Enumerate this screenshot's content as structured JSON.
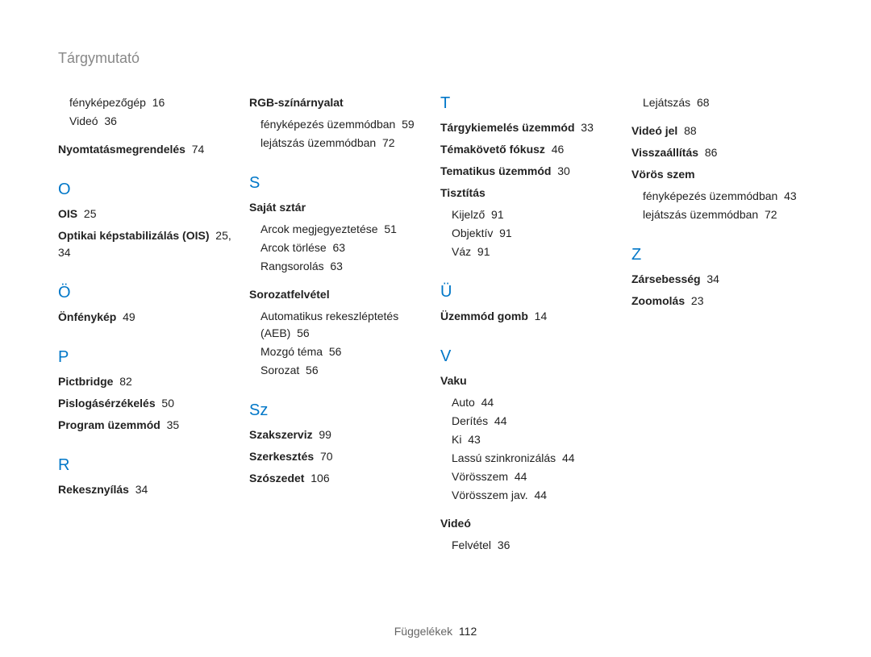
{
  "title": "Tárgymutató",
  "footer": {
    "label": "Függelékek",
    "page": "112"
  },
  "col1": {
    "cont_sub1": {
      "label": "fényképezőgép",
      "pg": "16"
    },
    "cont_sub2": {
      "label": "Videó",
      "pg": "36"
    },
    "nyomt": {
      "label": "Nyomtatásmegrendelés",
      "pg": "74"
    },
    "O": "O",
    "ois": {
      "label": "OIS",
      "pg": "25"
    },
    "optikai": {
      "label": "Optikai képstabilizálás (OIS)",
      "pg": "25, 34"
    },
    "O2": "Ö",
    "onf": {
      "label": "Önfénykép",
      "pg": "49"
    },
    "P": "P",
    "pict": {
      "label": "Pictbridge",
      "pg": "82"
    },
    "pislog": {
      "label": "Pislogásérzékelés",
      "pg": "50"
    },
    "prog": {
      "label": "Program üzemmód",
      "pg": "35"
    },
    "R": "R",
    "rekesz": {
      "label": "Rekesznyílás",
      "pg": "34"
    }
  },
  "col2": {
    "rgb": {
      "label": "RGB-színárnyalat"
    },
    "rgb_sub1": {
      "label": "fényképezés üzemmódban",
      "pg": "59"
    },
    "rgb_sub2": {
      "label": "lejátszás üzemmódban",
      "pg": "72"
    },
    "S": "S",
    "sajat": {
      "label": "Saját sztár"
    },
    "sajat_sub1": {
      "label": "Arcok megjegyeztetése",
      "pg": "51"
    },
    "sajat_sub2": {
      "label": "Arcok törlése",
      "pg": "63"
    },
    "sajat_sub3": {
      "label": "Rangsorolás",
      "pg": "63"
    },
    "sorozat": {
      "label": "Sorozatfelvétel"
    },
    "sorozat_sub1": {
      "label": "Automatikus rekeszléptetés (AEB)",
      "pg": "56"
    },
    "sorozat_sub2": {
      "label": "Mozgó téma",
      "pg": "56"
    },
    "sorozat_sub3": {
      "label": "Sorozat",
      "pg": "56"
    },
    "Sz": "Sz",
    "szak": {
      "label": "Szakszerviz",
      "pg": "99"
    },
    "szerk": {
      "label": "Szerkesztés",
      "pg": "70"
    },
    "szosz": {
      "label": "Szószedet",
      "pg": "106"
    }
  },
  "col3": {
    "T": "T",
    "targy": {
      "label": "Tárgykiemelés üzemmód",
      "pg": "33"
    },
    "temakov": {
      "label": "Témakövető fókusz",
      "pg": "46"
    },
    "tematikus": {
      "label": "Tematikus üzemmód",
      "pg": "30"
    },
    "tiszt": {
      "label": "Tisztítás"
    },
    "tiszt_sub1": {
      "label": "Kijelző",
      "pg": "91"
    },
    "tiszt_sub2": {
      "label": "Objektív",
      "pg": "91"
    },
    "tiszt_sub3": {
      "label": "Váz",
      "pg": "91"
    },
    "U": "Ü",
    "uzemmod": {
      "label": "Üzemmód gomb",
      "pg": "14"
    },
    "V": "V",
    "vaku": {
      "label": "Vaku"
    },
    "vaku_sub1": {
      "label": "Auto",
      "pg": "44"
    },
    "vaku_sub2": {
      "label": "Derítés",
      "pg": "44"
    },
    "vaku_sub3": {
      "label": "Ki",
      "pg": "43"
    },
    "vaku_sub4": {
      "label": "Lassú szinkronizálás",
      "pg": "44"
    },
    "vaku_sub5": {
      "label": "Vörösszem",
      "pg": "44"
    },
    "vaku_sub6": {
      "label": "Vörösszem jav.",
      "pg": "44"
    },
    "video": {
      "label": "Videó"
    },
    "video_sub1": {
      "label": "Felvétel",
      "pg": "36"
    }
  },
  "col4": {
    "video_cont_sub": {
      "label": "Lejátszás",
      "pg": "68"
    },
    "videojel": {
      "label": "Videó jel",
      "pg": "88"
    },
    "vissza": {
      "label": "Visszaállítás",
      "pg": "86"
    },
    "voros": {
      "label": "Vörös szem"
    },
    "voros_sub1": {
      "label": "fényképezés üzemmódban",
      "pg": "43"
    },
    "voros_sub2": {
      "label": "lejátszás üzemmódban",
      "pg": "72"
    },
    "Z": "Z",
    "zarseb": {
      "label": "Zársebesség",
      "pg": "34"
    },
    "zoom": {
      "label": "Zoomolás",
      "pg": "23"
    }
  }
}
